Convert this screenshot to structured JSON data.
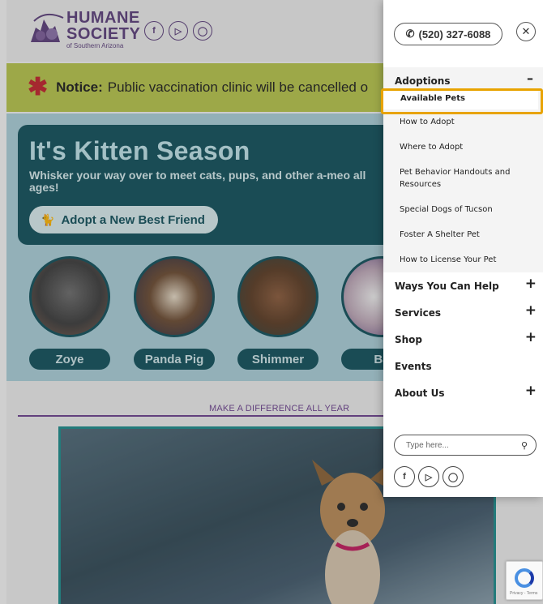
{
  "site": {
    "logo_line1": "HUMANE",
    "logo_line2": "SOCIETY",
    "logo_line3": "of Southern Arizona",
    "social_icons": [
      "facebook-icon",
      "youtube-icon",
      "instagram-icon"
    ]
  },
  "notice": {
    "label": "Notice:",
    "text": "Public vaccination clinic will be cancelled o"
  },
  "hero": {
    "title": "It's Kitten Season",
    "subtitle": "Whisker your way over to meet cats, pups, and other a-meo all ages!",
    "button_label": "Adopt a New Best Friend"
  },
  "pets": [
    {
      "name": "Zoye"
    },
    {
      "name": "Panda Pig"
    },
    {
      "name": "Shimmer"
    },
    {
      "name": "Ba"
    }
  ],
  "section": {
    "heading": "MAKE A DIFFERENCE ALL YEAR"
  },
  "menu": {
    "phone": "(520) 327-6088",
    "adoptions": {
      "label": "Adoptions",
      "toggle": "–",
      "items": [
        "Available Pets",
        "How to Adopt",
        "Where to Adopt",
        "Pet Behavior Handouts and Resources",
        "Special Dogs of Tucson",
        "Foster A Shelter Pet",
        "How to License Your Pet"
      ]
    },
    "main_items": [
      {
        "label": "Ways You Can Help",
        "toggle": "+"
      },
      {
        "label": "Services",
        "toggle": "+"
      },
      {
        "label": "Shop",
        "toggle": "+"
      },
      {
        "label": "Events",
        "toggle": ""
      },
      {
        "label": "About Us",
        "toggle": "+"
      }
    ],
    "search_placeholder": "Type here..."
  },
  "colors": {
    "highlight": "#e8a300",
    "brand_teal": "#0f4f5a",
    "brand_purple": "#5a3d7a",
    "notice_bg": "#b6c44a"
  }
}
